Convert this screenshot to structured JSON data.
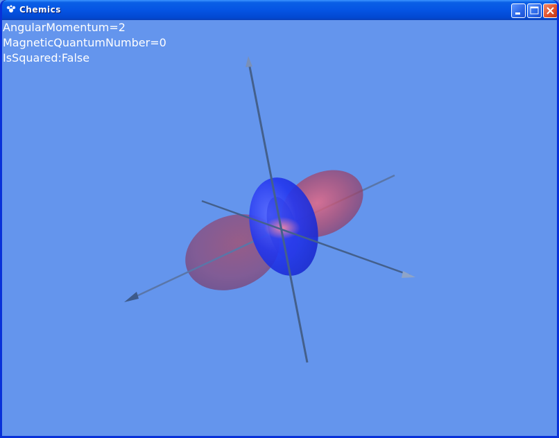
{
  "window": {
    "title": "Chemics",
    "title_icon": "app-icon",
    "controls": [
      "minimize-icon",
      "maximize-icon",
      "close-icon"
    ]
  },
  "info": {
    "angular_momentum": "AngularMomentum=2",
    "magnetic_quantum_number": "MagneticQuantumNumber=0",
    "is_squared": "IsSquared:False"
  },
  "colors": {
    "background": "#6495ED",
    "positive_lobe": "#e0506a",
    "negative_lobe": "#2233ee",
    "axis": "#44608c"
  }
}
